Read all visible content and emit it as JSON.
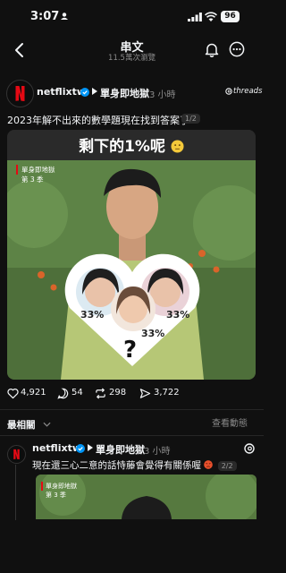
{
  "status": {
    "time": "3:07",
    "battery": "96"
  },
  "nav": {
    "title": "串文",
    "subtitle": "11.5萬次瀏覽"
  },
  "post": {
    "username": "netflixtw",
    "tag": "單身即地獄",
    "time": "3 小時",
    "threads_label": "threads",
    "text": "2023年解不出來的數學題現在找到答案了",
    "page_badge": "1/2",
    "media": {
      "headline": "剩下的1%呢",
      "show_line1": "單身即地獄",
      "show_line2": "第 3 季",
      "pct_left": "33%",
      "pct_center": "33%",
      "pct_right": "33%",
      "question": "?"
    },
    "stats": {
      "likes": "4,921",
      "comments": "54",
      "reposts": "298",
      "shares": "3,722"
    }
  },
  "sort": {
    "label": "最相關",
    "view_activity": "查看動態"
  },
  "reply": {
    "username": "netflixtw",
    "tag": "單身即地獄",
    "time": "3 小時",
    "text": "現在還三心二意的話恃藤會覺得有關係喔",
    "page_badge": "2/2",
    "media": {
      "show_line1": "單身即地獄",
      "show_line2": "第 3 季"
    }
  },
  "colors": {
    "netflix_red": "#e50914",
    "verified_blue": "#0095f6",
    "background": "#101010"
  }
}
